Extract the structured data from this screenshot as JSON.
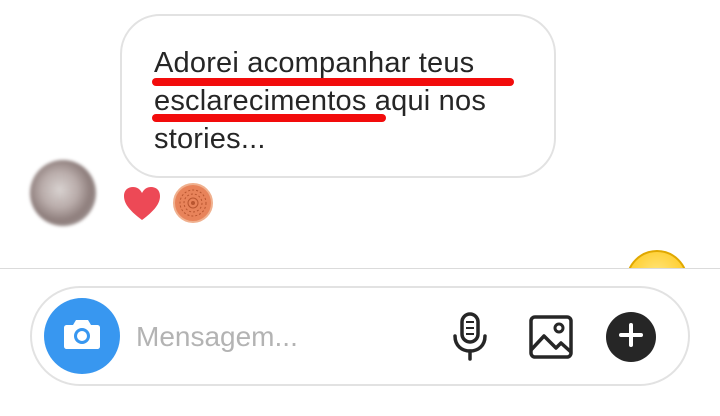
{
  "message": {
    "lines": [
      "Adorei acompanhar teus",
      "esclarecimentos aqui nos",
      "stories..."
    ],
    "highlight_color": "#f20c0c"
  },
  "reactions": {
    "heart_icon": "heart-icon",
    "heart_color": "#ed4956",
    "second_icon": "ring-reaction-icon",
    "second_color": "#e8835a"
  },
  "composer": {
    "placeholder": "Mensagem...",
    "value": "",
    "camera_color": "#3897f0",
    "icons": [
      "camera-icon",
      "microphone-icon",
      "gallery-icon",
      "plus-icon"
    ]
  }
}
